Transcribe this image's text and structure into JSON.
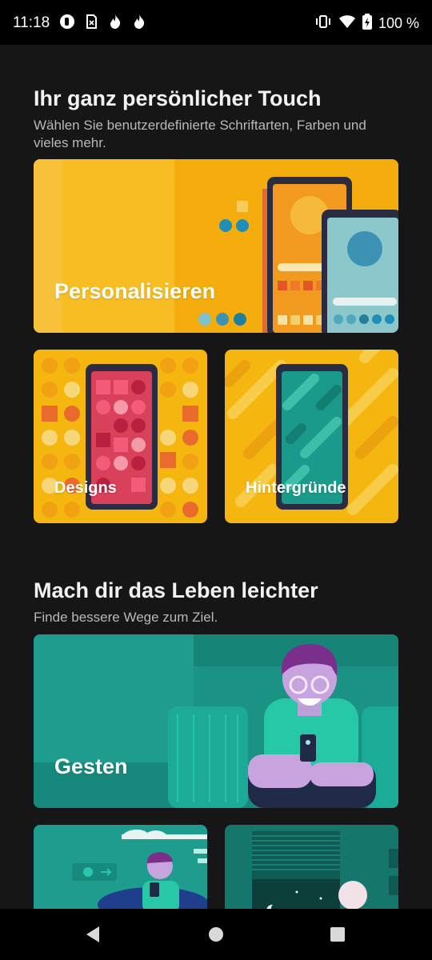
{
  "status_bar": {
    "time": "11:18",
    "battery": "100 %",
    "icons_left": [
      "app-notification-icon",
      "sim-card-icon",
      "flame-icon",
      "flame-icon"
    ],
    "icons_right": [
      "vibrate-icon",
      "wifi-icon",
      "battery-charging-icon"
    ]
  },
  "section_personal": {
    "title": "Ihr ganz persönlicher Touch",
    "subtitle": "Wählen Sie benutzerdefinierte Schriftarten, Farben und vieles mehr.",
    "cards": {
      "personalize": "Personalisieren",
      "themes": "Designs",
      "wallpapers": "Hintergründe"
    }
  },
  "section_easier": {
    "title": "Mach dir das Leben leichter",
    "subtitle": "Finde bessere Wege zum Ziel.",
    "cards": {
      "gestures": "Gesten"
    }
  },
  "colors": {
    "yellow": "#f5b70f",
    "teal": "#1e9c8e",
    "background": "#161616"
  },
  "nav": {
    "back": "back-icon",
    "home": "home-icon",
    "recents": "recents-icon"
  }
}
